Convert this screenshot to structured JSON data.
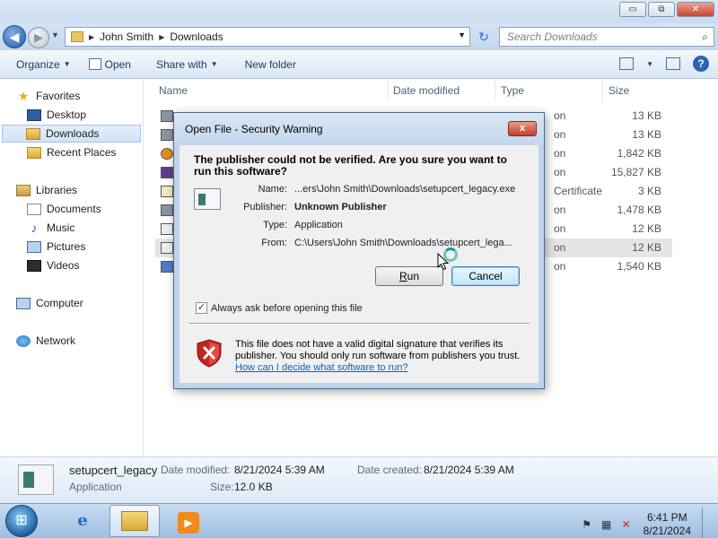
{
  "window": {
    "minimize": "▭",
    "maximize": "⧉",
    "close": "✕"
  },
  "address": {
    "crumbs": [
      "John Smith",
      "Downloads"
    ],
    "search_placeholder": "Search Downloads"
  },
  "toolbar": {
    "organize": "Organize",
    "open": "Open",
    "share_with": "Share with",
    "new_folder": "New folder"
  },
  "nav": {
    "favorites": "Favorites",
    "desktop": "Desktop",
    "downloads": "Downloads",
    "recent_places": "Recent Places",
    "libraries": "Libraries",
    "documents": "Documents",
    "music": "Music",
    "pictures": "Pictures",
    "videos": "Videos",
    "computer": "Computer",
    "network": "Network"
  },
  "columns": {
    "name": "Name",
    "date_modified": "Date modified",
    "type": "Type",
    "size": "Size"
  },
  "rows": [
    {
      "type": "on",
      "size": "13 KB"
    },
    {
      "type": "on",
      "size": "13 KB"
    },
    {
      "type": "on",
      "size": "1,842 KB"
    },
    {
      "type": "on",
      "size": "15,827 KB"
    },
    {
      "type": "Certificate",
      "size": "3 KB"
    },
    {
      "type": "on",
      "size": "1,478 KB"
    },
    {
      "type": "on",
      "size": "12 KB"
    },
    {
      "type": "on",
      "size": "12 KB"
    },
    {
      "type": "on",
      "size": "1,540 KB"
    }
  ],
  "details": {
    "name": "setupcert_legacy",
    "type": "Application",
    "date_modified_label": "Date modified:",
    "date_modified": "8/21/2024 5:39 AM",
    "date_created_label": "Date created:",
    "date_created": "8/21/2024 5:39 AM",
    "size_label": "Size:",
    "size": "12.0 KB"
  },
  "dialog": {
    "title": "Open File - Security Warning",
    "close": "x",
    "question": "The publisher could not be verified.  Are you sure you want to run this software?",
    "name_label": "Name:",
    "name_value": "...ers\\John Smith\\Downloads\\setupcert_legacy.exe",
    "publisher_label": "Publisher:",
    "publisher_value": "Unknown Publisher",
    "type_label": "Type:",
    "type_value": "Application",
    "from_label": "From:",
    "from_value": "C:\\Users\\John Smith\\Downloads\\setupcert_lega...",
    "run_accel": "R",
    "run_rest": "un",
    "cancel": "Cancel",
    "checkbox_mark": "✓",
    "checkbox_label": "Always ask before opening this file",
    "warning_text": "This file does not have a valid digital signature that verifies its publisher.  You should only run software from publishers you trust.",
    "help_link": "How can I decide what software to run?"
  },
  "taskbar": {
    "time": "6:41 PM",
    "date": "8/21/2024"
  },
  "colors": {
    "accent": "#3c7fb1",
    "link": "#0066cc",
    "shield_red": "#c8231f"
  }
}
